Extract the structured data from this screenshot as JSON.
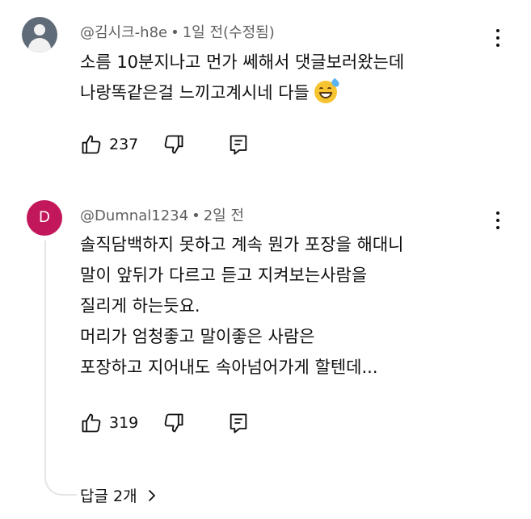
{
  "comments": [
    {
      "author": "@김시크-h8e",
      "time": "1일 전(수정됨)",
      "avatar_type": "person-placeholder",
      "text": "소름 10분지나고 먼가 쎄해서 댓글보러왔는데\n나랑똑같은걸 느끼고계시네 다들",
      "emoji": "sweat-smile-emoji",
      "likes": "237"
    },
    {
      "author": "@Dumnal1234",
      "time": "2일 전",
      "avatar_letter": "D",
      "avatar_color": "#c2185b",
      "text": "솔직담백하지 못하고 계속 뭔가 포장을 해대니\n말이 앞뒤가 다르고 듣고 지켜보는사람을\n질리게 하는듯요.\n머리가 엄청좋고 말이좋은 사람은\n포장하고 지어내도 속아넘어가게 할텐데...",
      "likes": "319",
      "replies_label": "답글 2개"
    }
  ],
  "separator": "•"
}
